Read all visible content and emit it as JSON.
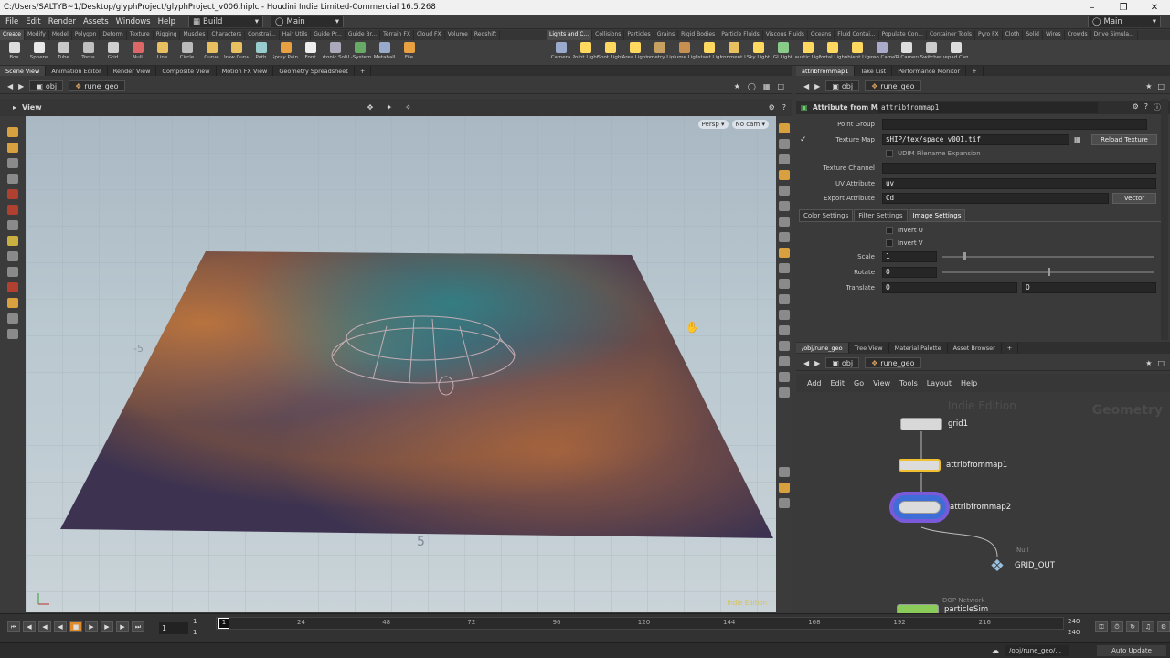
{
  "window": {
    "title": "C:/Users/SALTYB~1/Desktop/glyphProject/glyphProject_v006.hiplc - Houdini Indie Limited-Commercial 16.5.268"
  },
  "menu": {
    "items": [
      "File",
      "Edit",
      "Render",
      "Assets",
      "Windows",
      "Help"
    ],
    "desktop": "Build",
    "right_desktop": "Main",
    "main": "Main"
  },
  "shelf_tabs_left": [
    "Create",
    "Modify",
    "Model",
    "Polygon",
    "Deform",
    "Texture",
    "Rigging",
    "Muscles",
    "Characters",
    "Constrai...",
    "Hair Utils",
    "Guide Pr...",
    "Guide Br...",
    "Terrain FX",
    "Cloud FX",
    "Volume",
    "Redshift"
  ],
  "shelf_tabs_right": [
    "Lights and C...",
    "Collisions",
    "Particles",
    "Grains",
    "Rigid Bodies",
    "Particle Fluids",
    "Viscous Fluids",
    "Oceans",
    "Fluid Contai...",
    "Populate Con...",
    "Container Tools",
    "Pyro FX",
    "Cloth",
    "Solid",
    "Wires",
    "Crowds",
    "Drive Simula..."
  ],
  "tools_left": [
    "Box",
    "Sphere",
    "Tube",
    "Torus",
    "Grid",
    "Null",
    "Line",
    "Circle",
    "Curve",
    "Draw Curve",
    "Path",
    "Spray Paint",
    "Font",
    "Platonic Solids",
    "L-System",
    "Metaball",
    "File"
  ],
  "tools_right": [
    "Camera",
    "Point Light",
    "Spot Light",
    "Area Light",
    "Geometry Light",
    "Volume Light",
    "Distant Light",
    "Environment Light",
    "Sky Light",
    "GI Light",
    "Caustic Light",
    "Portal Light",
    "Ambient Light",
    "Stereo Camera",
    "VR Camera",
    "Switcher",
    "Gamepad Camera"
  ],
  "left_pane_tabs": [
    "Scene View",
    "Animation Editor",
    "Render View",
    "Composite View",
    "Motion FX View",
    "Geometry Spreadsheet"
  ],
  "path": {
    "obj": "obj",
    "geo": "rune_geo"
  },
  "view": {
    "label": "View",
    "persp": "Persp",
    "cam": "No cam",
    "watermark": "Indie Edition",
    "grid_label_a": "-5",
    "grid_label_b": "5"
  },
  "right_top_tabs": [
    "attribfrommap1",
    "Take List",
    "Performance Monitor"
  ],
  "params": {
    "node_type": "Attribute from Map",
    "node_name": "attribfrommap1",
    "point_group_label": "Point Group",
    "texture_map_label": "Texture Map",
    "texture_map_value": "$HIP/tex/space_v001.tif",
    "reload_button": "Reload Texture",
    "udim_label": "UDIM Filename Expansion",
    "texture_channel_label": "Texture Channel",
    "uv_attr_label": "UV Attribute",
    "uv_attr_value": "uv",
    "export_attr_label": "Export Attribute",
    "export_attr_value": "Cd",
    "export_type": "Vector",
    "tabs": [
      "Color Settings",
      "Filter Settings",
      "Image Settings"
    ],
    "invert_u": "Invert U",
    "invert_v": "Invert V",
    "scale_label": "Scale",
    "scale_value": "1",
    "rotate_label": "Rotate",
    "rotate_value": "0",
    "translate_label": "Translate",
    "translate_x": "0",
    "translate_y": "0"
  },
  "network_tabs": [
    "/obj/rune_geo",
    "Tree View",
    "Material Palette",
    "Asset Browser"
  ],
  "network_menu": [
    "Add",
    "Edit",
    "Go",
    "View",
    "Tools",
    "Layout",
    "Help"
  ],
  "network": {
    "watermark": "Indie Edition",
    "context": "Geometry",
    "nodes": {
      "grid": "grid1",
      "afm1": "attribfrommap1",
      "afm2": "attribfrommap2",
      "null_type": "Null",
      "out": "GRID_OUT",
      "dop_type": "DOP Network",
      "dop": "particleSim"
    }
  },
  "timeline": {
    "frame": "1",
    "start": "1",
    "start2": "1",
    "marker": "1",
    "ticks": [
      "24",
      "48",
      "72",
      "96",
      "120",
      "144",
      "168",
      "192",
      "216"
    ],
    "end": "240",
    "end2": "240"
  },
  "status": {
    "path": "/obj/rune_geo/...",
    "update": "Auto Update"
  },
  "colors": {
    "accent": "#f0c030",
    "panel": "#3a3a3a",
    "selection": "#ffcc33"
  }
}
